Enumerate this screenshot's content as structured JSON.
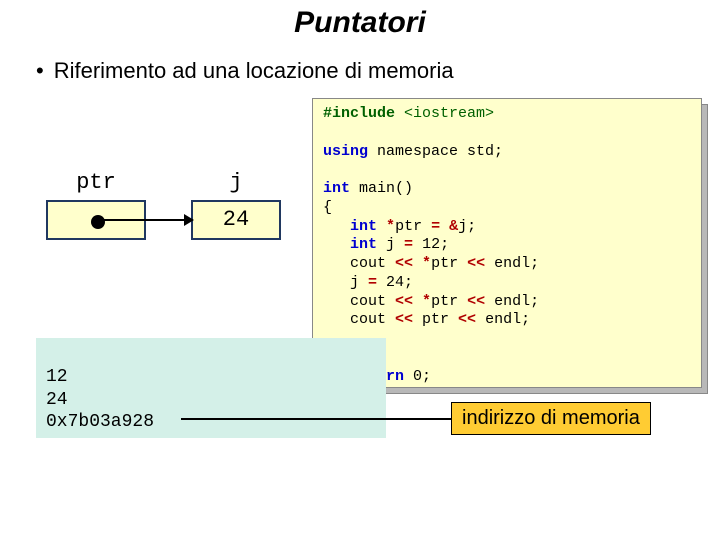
{
  "title": "Puntatori",
  "bullet": "Riferimento ad una locazione di memoria",
  "diagram": {
    "ptr_label": "ptr",
    "j_label": "j",
    "j_value": "24"
  },
  "code": {
    "l1_a": "#include ",
    "l1_b": "<iostream>",
    "l3_a": "using",
    "l3_b": " namespace std;",
    "l5_a": "int",
    "l5_b": " main()",
    "l6": "{",
    "l7_a": "   ",
    "l7_b": "int",
    "l7_c": " ",
    "l7_d": "*",
    "l7_e": "ptr ",
    "l7_f": "=",
    "l7_g": " ",
    "l7_h": "&",
    "l7_i": "j;",
    "l7x_a": "   ",
    "l7x_b": "int",
    "l7x_c": " j ",
    "l7x_d": "=",
    "l7x_e": " 12;",
    "l8_a": "   cout ",
    "l8_b": "<<",
    "l8_c": " ",
    "l8_d": "*",
    "l8_e": "ptr ",
    "l8_f": "<<",
    "l8_g": " endl;",
    "l9_a": "   j ",
    "l9_b": "=",
    "l9_c": " 24;",
    "l10_a": "   cout ",
    "l10_b": "<<",
    "l10_c": " ",
    "l10_d": "*",
    "l10_e": "ptr ",
    "l10_f": "<<",
    "l10_g": " endl;",
    "l11_a": "   cout ",
    "l11_b": "<<",
    "l11_c": " ptr ",
    "l11_d": "<<",
    "l11_e": " endl;",
    "l14_a": "   ",
    "l14_b": "return",
    "l14_c": " 0;",
    "l15": "}"
  },
  "output": {
    "l1": "12",
    "l2": "24",
    "l3": "0x7b03a928"
  },
  "callout": "indirizzo di memoria"
}
